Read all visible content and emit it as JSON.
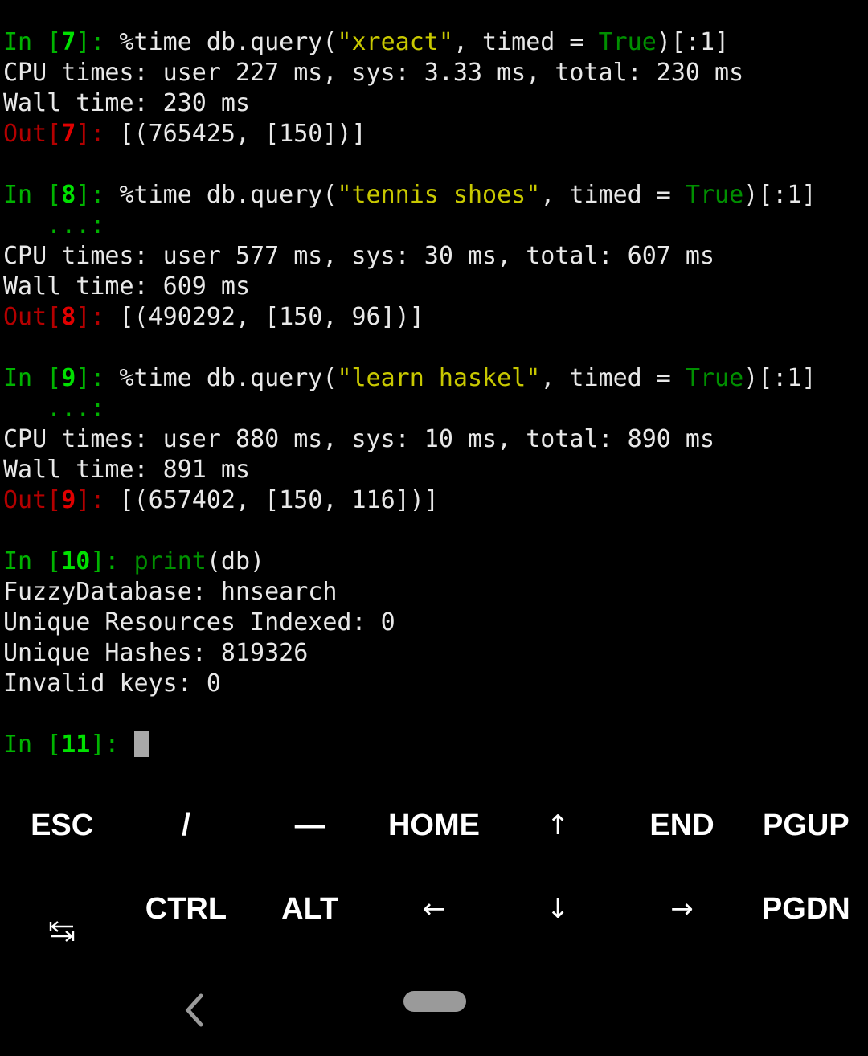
{
  "terminal": {
    "background_color": "#000000",
    "foreground_color": "#e8e8e8",
    "colors": {
      "prompt_in": "#00b300",
      "prompt_in_number": "#00e000",
      "prompt_out": "#b40000",
      "prompt_out_number": "#e00000",
      "string": "#c8c800",
      "keyword": "#008f00",
      "cursor": "#a8a8a8"
    },
    "cells": [
      {
        "prompt_label_open": "In [",
        "prompt_number": "7",
        "prompt_label_close": "]: ",
        "code_pre": "%time db.query(",
        "code_string": "\"xreact\"",
        "code_mid": ", timed = ",
        "code_keyword": "True",
        "code_post": ")[:1]",
        "continuation": null,
        "stdout": [
          "CPU times: user 227 ms, sys: 3.33 ms, total: 230 ms",
          "Wall time: 230 ms"
        ],
        "out_label_open": "Out[",
        "out_number": "7",
        "out_label_close": "]: ",
        "out_value": "[(765425, [150])]"
      },
      {
        "prompt_label_open": "In [",
        "prompt_number": "8",
        "prompt_label_close": "]: ",
        "code_pre": "%time db.query(",
        "code_string": "\"tennis shoes\"",
        "code_mid": ", timed = ",
        "code_keyword": "True",
        "code_post": ")[:1]",
        "continuation": "   ...:",
        "stdout": [
          "CPU times: user 577 ms, sys: 30 ms, total: 607 ms",
          "Wall time: 609 ms"
        ],
        "out_label_open": "Out[",
        "out_number": "8",
        "out_label_close": "]: ",
        "out_value": "[(490292, [150, 96])]"
      },
      {
        "prompt_label_open": "In [",
        "prompt_number": "9",
        "prompt_label_close": "]: ",
        "code_pre": "%time db.query(",
        "code_string": "\"learn haskel\"",
        "code_mid": ", timed = ",
        "code_keyword": "True",
        "code_post": ")[:1]",
        "continuation": "   ...:",
        "stdout": [
          "CPU times: user 880 ms, sys: 10 ms, total: 890 ms",
          "Wall time: 891 ms"
        ],
        "out_label_open": "Out[",
        "out_number": "9",
        "out_label_close": "]: ",
        "out_value": "[(657402, [150, 116])]"
      }
    ],
    "print_cell": {
      "prompt_label_open": "In [",
      "prompt_number": "10",
      "prompt_label_close": "]: ",
      "code_keyword": "print",
      "code_post": "(db)",
      "stdout": [
        "FuzzyDatabase: hnsearch",
        "Unique Resources Indexed: 0",
        "Unique Hashes: 819326",
        "Invalid keys: 0"
      ]
    },
    "active_prompt": {
      "prompt_label_open": "In [",
      "prompt_number": "11",
      "prompt_label_close": "]: ",
      "input_value": ""
    }
  },
  "keyboard": {
    "row1": [
      {
        "label": "ESC",
        "name": "key-esc",
        "kind": "text"
      },
      {
        "label": "/",
        "name": "key-slash",
        "kind": "text"
      },
      {
        "label": "—",
        "name": "key-dash",
        "kind": "text"
      },
      {
        "label": "HOME",
        "name": "key-home",
        "kind": "text"
      },
      {
        "label": "↑",
        "name": "key-arrow-up",
        "kind": "arrow"
      },
      {
        "label": "END",
        "name": "key-end",
        "kind": "text"
      },
      {
        "label": "PGUP",
        "name": "key-pgup",
        "kind": "text"
      }
    ],
    "row2": [
      {
        "label": "⇆",
        "name": "key-tab",
        "kind": "tab-icon"
      },
      {
        "label": "CTRL",
        "name": "key-ctrl",
        "kind": "text"
      },
      {
        "label": "ALT",
        "name": "key-alt",
        "kind": "text"
      },
      {
        "label": "←",
        "name": "key-arrow-left",
        "kind": "arrow"
      },
      {
        "label": "↓",
        "name": "key-arrow-down",
        "kind": "arrow"
      },
      {
        "label": "→",
        "name": "key-arrow-right",
        "kind": "arrow"
      },
      {
        "label": "PGDN",
        "name": "key-pgdn",
        "kind": "text"
      }
    ]
  },
  "nav_bar": {
    "back_icon": "chevron-left-icon",
    "home_pill": "home-pill",
    "color": "#9a9a9a"
  }
}
